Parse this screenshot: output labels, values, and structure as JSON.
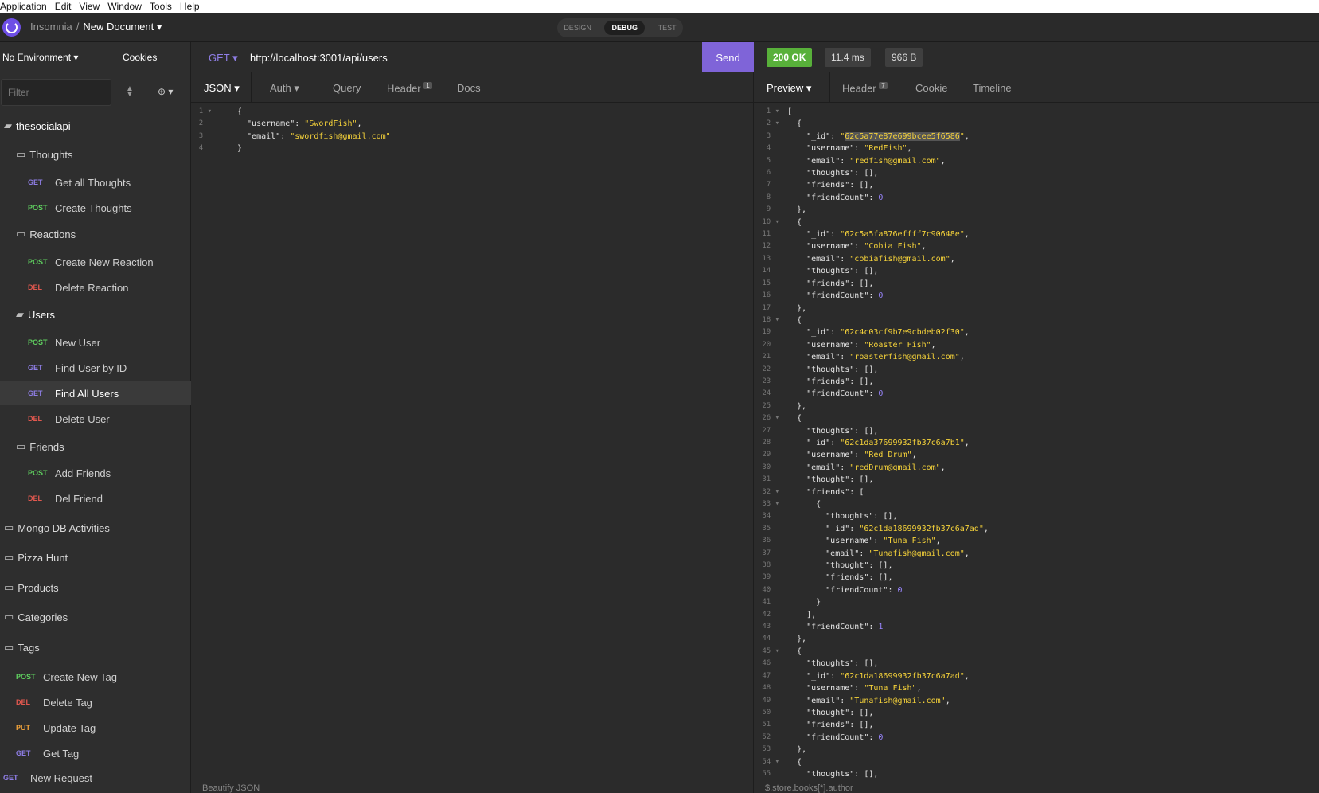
{
  "menu": [
    "Application",
    "Edit",
    "View",
    "Window",
    "Tools",
    "Help"
  ],
  "header": {
    "app": "Insomnia",
    "separator": "/",
    "document": "New Document ▾",
    "modes": [
      "DESIGN",
      "DEBUG",
      "TEST"
    ]
  },
  "sidebar": {
    "environment": "No Environment ▾",
    "cookies": "Cookies",
    "filter_placeholder": "Filter",
    "items": [
      {
        "kind": "folder",
        "label": "thesocialapi",
        "open": true,
        "top": true
      },
      {
        "kind": "folder",
        "label": "Thoughts"
      },
      {
        "kind": "req",
        "method": "GET",
        "label": "Get all Thoughts"
      },
      {
        "kind": "req",
        "method": "POST",
        "label": "Create Thoughts"
      },
      {
        "kind": "folder",
        "label": "Reactions"
      },
      {
        "kind": "req",
        "method": "POST",
        "label": "Create New Reaction"
      },
      {
        "kind": "req",
        "method": "DEL",
        "label": "Delete Reaction"
      },
      {
        "kind": "folder",
        "label": "Users",
        "open": true
      },
      {
        "kind": "req",
        "method": "POST",
        "label": "New User"
      },
      {
        "kind": "req",
        "method": "GET",
        "label": "Find User by ID"
      },
      {
        "kind": "req",
        "method": "GET",
        "label": "Find All Users",
        "selected": true
      },
      {
        "kind": "req",
        "method": "DEL",
        "label": "Delete User"
      },
      {
        "kind": "folder",
        "label": "Friends"
      },
      {
        "kind": "req",
        "method": "POST",
        "label": "Add Friends"
      },
      {
        "kind": "req",
        "method": "DEL",
        "label": "Del Friend"
      },
      {
        "kind": "folder",
        "label": "Mongo DB Activities",
        "top": true
      },
      {
        "kind": "folder",
        "label": "Pizza Hunt",
        "top": true
      },
      {
        "kind": "folder",
        "label": "Products",
        "top": true
      },
      {
        "kind": "folder",
        "label": "Categories",
        "top": true
      },
      {
        "kind": "folder",
        "label": "Tags",
        "top": true
      },
      {
        "kind": "req",
        "method": "POST",
        "label": "Create New Tag",
        "sub": true
      },
      {
        "kind": "req",
        "method": "DEL",
        "label": "Delete Tag",
        "sub": true
      },
      {
        "kind": "req",
        "method": "PUT",
        "label": "Update Tag",
        "sub": true
      },
      {
        "kind": "req",
        "method": "GET",
        "label": "Get Tag",
        "sub": true
      },
      {
        "kind": "req",
        "method": "GET",
        "label": "New Request",
        "root": true
      }
    ]
  },
  "request": {
    "method": "GET ▾",
    "url": "http://localhost:3001/api/users",
    "send": "Send",
    "tabs": [
      "JSON ▾",
      "Auth ▾",
      "Query",
      "Header",
      "Docs"
    ],
    "header_count": "1",
    "body_lines": [
      [
        [
          "p",
          "{"
        ]
      ],
      [
        [
          "k",
          "  \"username\""
        ],
        [
          "p",
          ": "
        ],
        [
          "s",
          "\"SwordFish\""
        ],
        [
          "p",
          ","
        ]
      ],
      [
        [
          "k",
          "  \"email\""
        ],
        [
          "p",
          ": "
        ],
        [
          "s",
          "\"swordfish@gmail.com\""
        ]
      ],
      [
        [
          "p",
          "}"
        ]
      ]
    ],
    "footer": "Beautify JSON"
  },
  "response": {
    "status": "200 OK",
    "time": "11.4 ms",
    "size": "966 B",
    "tabs": [
      "Preview ▾",
      "Header",
      "Cookie",
      "Timeline"
    ],
    "header_count": "7",
    "lines": [
      [
        [
          "p",
          "["
        ]
      ],
      [
        [
          "p",
          "  {"
        ]
      ],
      [
        [
          "k",
          "    \"_id\""
        ],
        [
          "p",
          ": "
        ],
        [
          "s",
          "\""
        ],
        [
          "h",
          "62c5a77e87e699bcee5f6586"
        ],
        [
          "s",
          "\""
        ],
        [
          "p",
          ","
        ]
      ],
      [
        [
          "k",
          "    \"username\""
        ],
        [
          "p",
          ": "
        ],
        [
          "s",
          "\"RedFish\""
        ],
        [
          "p",
          ","
        ]
      ],
      [
        [
          "k",
          "    \"email\""
        ],
        [
          "p",
          ": "
        ],
        [
          "s",
          "\"redfish@gmail.com\""
        ],
        [
          "p",
          ","
        ]
      ],
      [
        [
          "k",
          "    \"thoughts\""
        ],
        [
          "p",
          ": [],"
        ]
      ],
      [
        [
          "k",
          "    \"friends\""
        ],
        [
          "p",
          ": [],"
        ]
      ],
      [
        [
          "k",
          "    \"friendCount\""
        ],
        [
          "p",
          ": "
        ],
        [
          "n",
          "0"
        ]
      ],
      [
        [
          "p",
          "  },"
        ]
      ],
      [
        [
          "p",
          "  {"
        ]
      ],
      [
        [
          "k",
          "    \"_id\""
        ],
        [
          "p",
          ": "
        ],
        [
          "s",
          "\"62c5a5fa876effff7c90648e\""
        ],
        [
          "p",
          ","
        ]
      ],
      [
        [
          "k",
          "    \"username\""
        ],
        [
          "p",
          ": "
        ],
        [
          "s",
          "\"Cobia Fish\""
        ],
        [
          "p",
          ","
        ]
      ],
      [
        [
          "k",
          "    \"email\""
        ],
        [
          "p",
          ": "
        ],
        [
          "s",
          "\"cobiafish@gmail.com\""
        ],
        [
          "p",
          ","
        ]
      ],
      [
        [
          "k",
          "    \"thoughts\""
        ],
        [
          "p",
          ": [],"
        ]
      ],
      [
        [
          "k",
          "    \"friends\""
        ],
        [
          "p",
          ": [],"
        ]
      ],
      [
        [
          "k",
          "    \"friendCount\""
        ],
        [
          "p",
          ": "
        ],
        [
          "n",
          "0"
        ]
      ],
      [
        [
          "p",
          "  },"
        ]
      ],
      [
        [
          "p",
          "  {"
        ]
      ],
      [
        [
          "k",
          "    \"_id\""
        ],
        [
          "p",
          ": "
        ],
        [
          "s",
          "\"62c4c03cf9b7e9cbdeb02f30\""
        ],
        [
          "p",
          ","
        ]
      ],
      [
        [
          "k",
          "    \"username\""
        ],
        [
          "p",
          ": "
        ],
        [
          "s",
          "\"Roaster Fish\""
        ],
        [
          "p",
          ","
        ]
      ],
      [
        [
          "k",
          "    \"email\""
        ],
        [
          "p",
          ": "
        ],
        [
          "s",
          "\"roasterfish@gmail.com\""
        ],
        [
          "p",
          ","
        ]
      ],
      [
        [
          "k",
          "    \"thoughts\""
        ],
        [
          "p",
          ": [],"
        ]
      ],
      [
        [
          "k",
          "    \"friends\""
        ],
        [
          "p",
          ": [],"
        ]
      ],
      [
        [
          "k",
          "    \"friendCount\""
        ],
        [
          "p",
          ": "
        ],
        [
          "n",
          "0"
        ]
      ],
      [
        [
          "p",
          "  },"
        ]
      ],
      [
        [
          "p",
          "  {"
        ]
      ],
      [
        [
          "k",
          "    \"thoughts\""
        ],
        [
          "p",
          ": [],"
        ]
      ],
      [
        [
          "k",
          "    \"_id\""
        ],
        [
          "p",
          ": "
        ],
        [
          "s",
          "\"62c1da37699932fb37c6a7b1\""
        ],
        [
          "p",
          ","
        ]
      ],
      [
        [
          "k",
          "    \"username\""
        ],
        [
          "p",
          ": "
        ],
        [
          "s",
          "\"Red Drum\""
        ],
        [
          "p",
          ","
        ]
      ],
      [
        [
          "k",
          "    \"email\""
        ],
        [
          "p",
          ": "
        ],
        [
          "s",
          "\"redDrum@gmail.com\""
        ],
        [
          "p",
          ","
        ]
      ],
      [
        [
          "k",
          "    \"thought\""
        ],
        [
          "p",
          ": [],"
        ]
      ],
      [
        [
          "k",
          "    \"friends\""
        ],
        [
          "p",
          ": ["
        ]
      ],
      [
        [
          "p",
          "      {"
        ]
      ],
      [
        [
          "k",
          "        \"thoughts\""
        ],
        [
          "p",
          ": [],"
        ]
      ],
      [
        [
          "k",
          "        \"_id\""
        ],
        [
          "p",
          ": "
        ],
        [
          "s",
          "\"62c1da18699932fb37c6a7ad\""
        ],
        [
          "p",
          ","
        ]
      ],
      [
        [
          "k",
          "        \"username\""
        ],
        [
          "p",
          ": "
        ],
        [
          "s",
          "\"Tuna Fish\""
        ],
        [
          "p",
          ","
        ]
      ],
      [
        [
          "k",
          "        \"email\""
        ],
        [
          "p",
          ": "
        ],
        [
          "s",
          "\"Tunafish@gmail.com\""
        ],
        [
          "p",
          ","
        ]
      ],
      [
        [
          "k",
          "        \"thought\""
        ],
        [
          "p",
          ": [],"
        ]
      ],
      [
        [
          "k",
          "        \"friends\""
        ],
        [
          "p",
          ": [],"
        ]
      ],
      [
        [
          "k",
          "        \"friendCount\""
        ],
        [
          "p",
          ": "
        ],
        [
          "n",
          "0"
        ]
      ],
      [
        [
          "p",
          "      }"
        ]
      ],
      [
        [
          "p",
          "    ],"
        ]
      ],
      [
        [
          "k",
          "    \"friendCount\""
        ],
        [
          "p",
          ": "
        ],
        [
          "n",
          "1"
        ]
      ],
      [
        [
          "p",
          "  },"
        ]
      ],
      [
        [
          "p",
          "  {"
        ]
      ],
      [
        [
          "k",
          "    \"thoughts\""
        ],
        [
          "p",
          ": [],"
        ]
      ],
      [
        [
          "k",
          "    \"_id\""
        ],
        [
          "p",
          ": "
        ],
        [
          "s",
          "\"62c1da18699932fb37c6a7ad\""
        ],
        [
          "p",
          ","
        ]
      ],
      [
        [
          "k",
          "    \"username\""
        ],
        [
          "p",
          ": "
        ],
        [
          "s",
          "\"Tuna Fish\""
        ],
        [
          "p",
          ","
        ]
      ],
      [
        [
          "k",
          "    \"email\""
        ],
        [
          "p",
          ": "
        ],
        [
          "s",
          "\"Tunafish@gmail.com\""
        ],
        [
          "p",
          ","
        ]
      ],
      [
        [
          "k",
          "    \"thought\""
        ],
        [
          "p",
          ": [],"
        ]
      ],
      [
        [
          "k",
          "    \"friends\""
        ],
        [
          "p",
          ": [],"
        ]
      ],
      [
        [
          "k",
          "    \"friendCount\""
        ],
        [
          "p",
          ": "
        ],
        [
          "n",
          "0"
        ]
      ],
      [
        [
          "p",
          "  },"
        ]
      ],
      [
        [
          "p",
          "  {"
        ]
      ],
      [
        [
          "k",
          "    \"thoughts\""
        ],
        [
          "p",
          ": [],"
        ]
      ]
    ],
    "footer": "$.store.books[*].author"
  }
}
